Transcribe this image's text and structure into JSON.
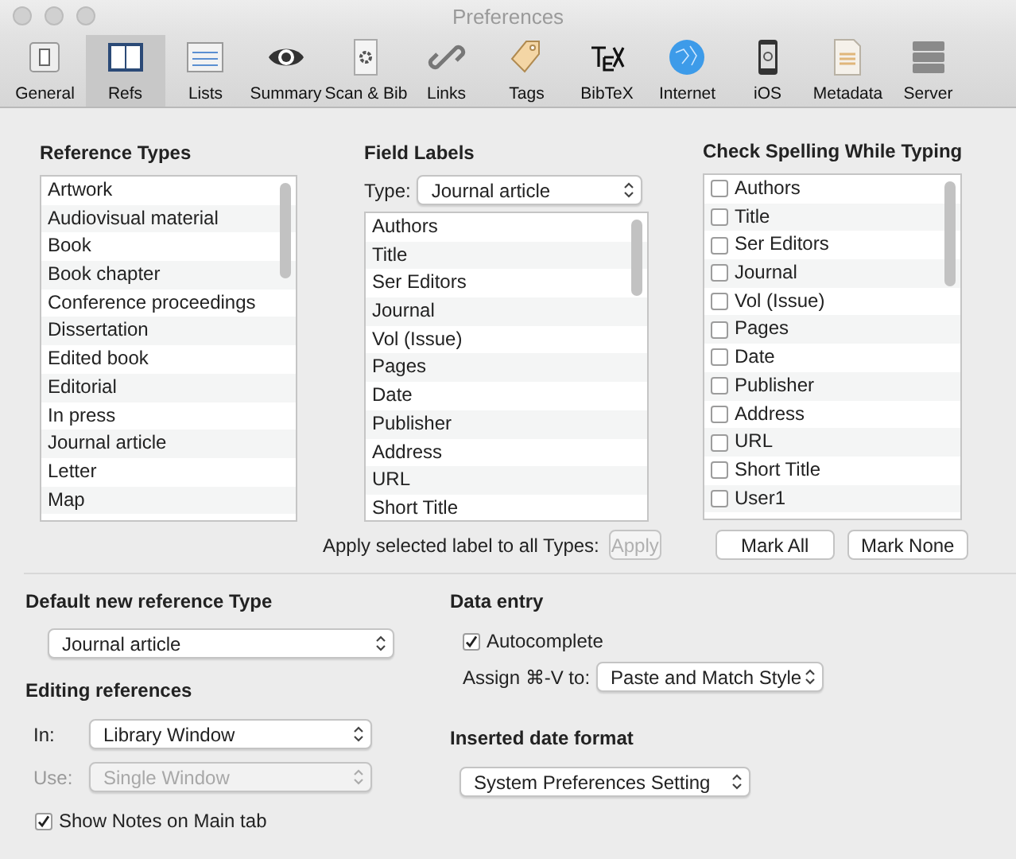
{
  "window": {
    "title": "Preferences"
  },
  "toolbar": [
    {
      "label": "General",
      "selected": false
    },
    {
      "label": "Refs",
      "selected": true
    },
    {
      "label": "Lists",
      "selected": false
    },
    {
      "label": "Summary",
      "selected": false
    },
    {
      "label": "Scan & Bib",
      "selected": false
    },
    {
      "label": "Links",
      "selected": false
    },
    {
      "label": "Tags",
      "selected": false
    },
    {
      "label": "BibTeX",
      "selected": false
    },
    {
      "label": "Internet",
      "selected": false
    },
    {
      "label": "iOS",
      "selected": false
    },
    {
      "label": "Metadata",
      "selected": false
    },
    {
      "label": "Server",
      "selected": false
    }
  ],
  "reference_types": {
    "heading": "Reference Types",
    "items": [
      "Artwork",
      "Audiovisual material",
      "Book",
      "Book chapter",
      "Conference proceedings",
      "Dissertation",
      "Edited book",
      "Editorial",
      "In press",
      "Journal article",
      "Letter",
      "Map"
    ]
  },
  "field_labels": {
    "heading": "Field Labels",
    "type_label": "Type:",
    "type_popup": {
      "value": "Journal article",
      "disabled": false
    },
    "items": [
      "Authors",
      "Title",
      "Ser Editors",
      "Journal",
      "Vol (Issue)",
      "Pages",
      "Date",
      "Publisher",
      "Address",
      "URL",
      "Short Title"
    ],
    "apply_label": "Apply selected label to all Types:",
    "apply_button": {
      "label": "Apply",
      "disabled": true
    }
  },
  "check_spelling": {
    "heading": "Check Spelling While Typing",
    "items": [
      {
        "label": "Authors",
        "checked": false
      },
      {
        "label": "Title",
        "checked": false
      },
      {
        "label": "Ser Editors",
        "checked": false
      },
      {
        "label": "Journal",
        "checked": false
      },
      {
        "label": "Vol (Issue)",
        "checked": false
      },
      {
        "label": "Pages",
        "checked": false
      },
      {
        "label": "Date",
        "checked": false
      },
      {
        "label": "Publisher",
        "checked": false
      },
      {
        "label": "Address",
        "checked": false
      },
      {
        "label": "URL",
        "checked": false
      },
      {
        "label": "Short Title",
        "checked": false
      },
      {
        "label": "User1",
        "checked": false
      }
    ],
    "buttons": [
      "Mark All",
      "Mark None"
    ]
  },
  "default_type": {
    "heading": "Default new reference Type",
    "popup": {
      "value": "Journal article",
      "disabled": false
    }
  },
  "editing": {
    "heading": "Editing references",
    "in_label": "In:",
    "in_popup": {
      "value": "Library Window",
      "disabled": false
    },
    "use_label": "Use:",
    "use_popup": {
      "value": "Single Window",
      "disabled": true
    },
    "show_notes": {
      "label": "Show Notes on Main tab",
      "checked": true
    }
  },
  "data_entry": {
    "heading": "Data entry",
    "autocomplete": {
      "label": "Autocomplete",
      "checked": true
    },
    "assign_label": "Assign ⌘-V to:",
    "assign_popup": {
      "value": "Paste and Match Style",
      "disabled": false
    }
  },
  "date_format": {
    "heading": "Inserted date format",
    "popup": {
      "value": "System Preferences Setting",
      "disabled": false
    }
  }
}
